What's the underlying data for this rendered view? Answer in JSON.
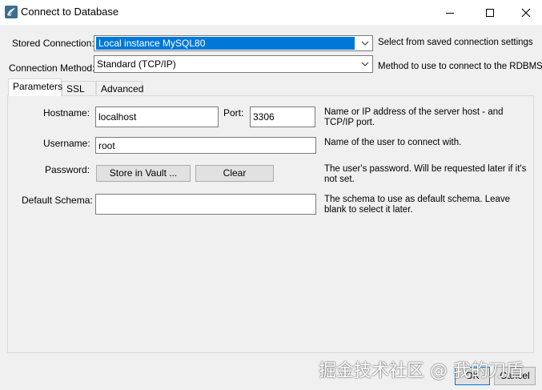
{
  "window": {
    "title": "Connect to Database"
  },
  "header": {
    "stored_connection_label": "Stored Connection:",
    "stored_connection_value": "Local instance MySQL80",
    "stored_connection_hint": "Select from saved connection settings",
    "connection_method_label": "Connection Method:",
    "connection_method_value": "Standard (TCP/IP)",
    "connection_method_hint": "Method to use to connect to the RDBMS"
  },
  "tabs": [
    {
      "label": "Parameters",
      "active": true
    },
    {
      "label": "SSL",
      "active": false
    },
    {
      "label": "Advanced",
      "active": false
    }
  ],
  "params": {
    "hostname_label": "Hostname:",
    "hostname_value": "localhost",
    "port_label": "Port:",
    "port_value": "3306",
    "hostname_desc_1": "Name or IP address of the server host - and",
    "hostname_desc_2": "TCP/IP port.",
    "username_label": "Username:",
    "username_value": "root",
    "username_desc": "Name of the user to connect with.",
    "password_label": "Password:",
    "store_vault_label": "Store in Vault ...",
    "clear_label": "Clear",
    "password_desc_1": "The user's password. Will be requested later if it's",
    "password_desc_2": "not set.",
    "schema_label": "Default Schema:",
    "schema_value": "",
    "schema_desc_1": "The schema to use as default schema. Leave",
    "schema_desc_2": "blank to select it later."
  },
  "footer": {
    "ok_label": "OK",
    "cancel_label": "Cancel",
    "watermark": "掘金技术社区 @ 我的刀盾"
  },
  "icons": {
    "app": "mysql-workbench-icon",
    "minimize": "minimize-icon",
    "maximize": "maximize-icon",
    "close": "close-icon",
    "dropdown": "chevron-down-icon"
  },
  "colors": {
    "selection": "#0078d7",
    "window_bg": "#f0f0f0"
  }
}
